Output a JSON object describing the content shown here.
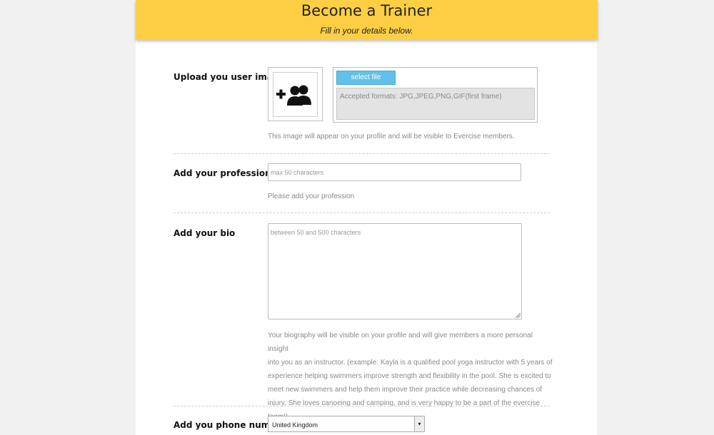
{
  "header": {
    "title": "Become a Trainer",
    "subtitle": "Fill in your details below."
  },
  "image_section": {
    "label": "Upload you user image",
    "select_button": "select file",
    "formats_text": "Accepted formats: JPG,JPEG,PNG,GIF(first frame)",
    "help": "This image will appear on your profile and will be visible to Evercise members.",
    "icon": "add-user-icon"
  },
  "profession_section": {
    "label": "Add your profession",
    "placeholder": "max 50 characters",
    "help": "Please add your profession"
  },
  "bio_section": {
    "label": "Add your bio",
    "placeholder": "between 50 and 500 characters",
    "help_lines": [
      "Your biography will be visible on your profile and will give members a more personal insight",
      "into you as an instructor. (example: Kayla is a qualified pool yoga instructor with 5 years of",
      "experience helping swimmers improve strength and flexibility in the pool. She is excited to",
      "meet new swimmers and help them improve their practice while decreasing chances of",
      "injury. She loves canoeing and camping, and is very happy to be a part of the evercise team!)"
    ]
  },
  "phone_section": {
    "label": "Add you phone number",
    "country_selected": "United Kingdom"
  },
  "colors": {
    "header_bg": "#fecf44",
    "button_bg": "#62c1e8",
    "page_bg": "#f1f1f1"
  }
}
